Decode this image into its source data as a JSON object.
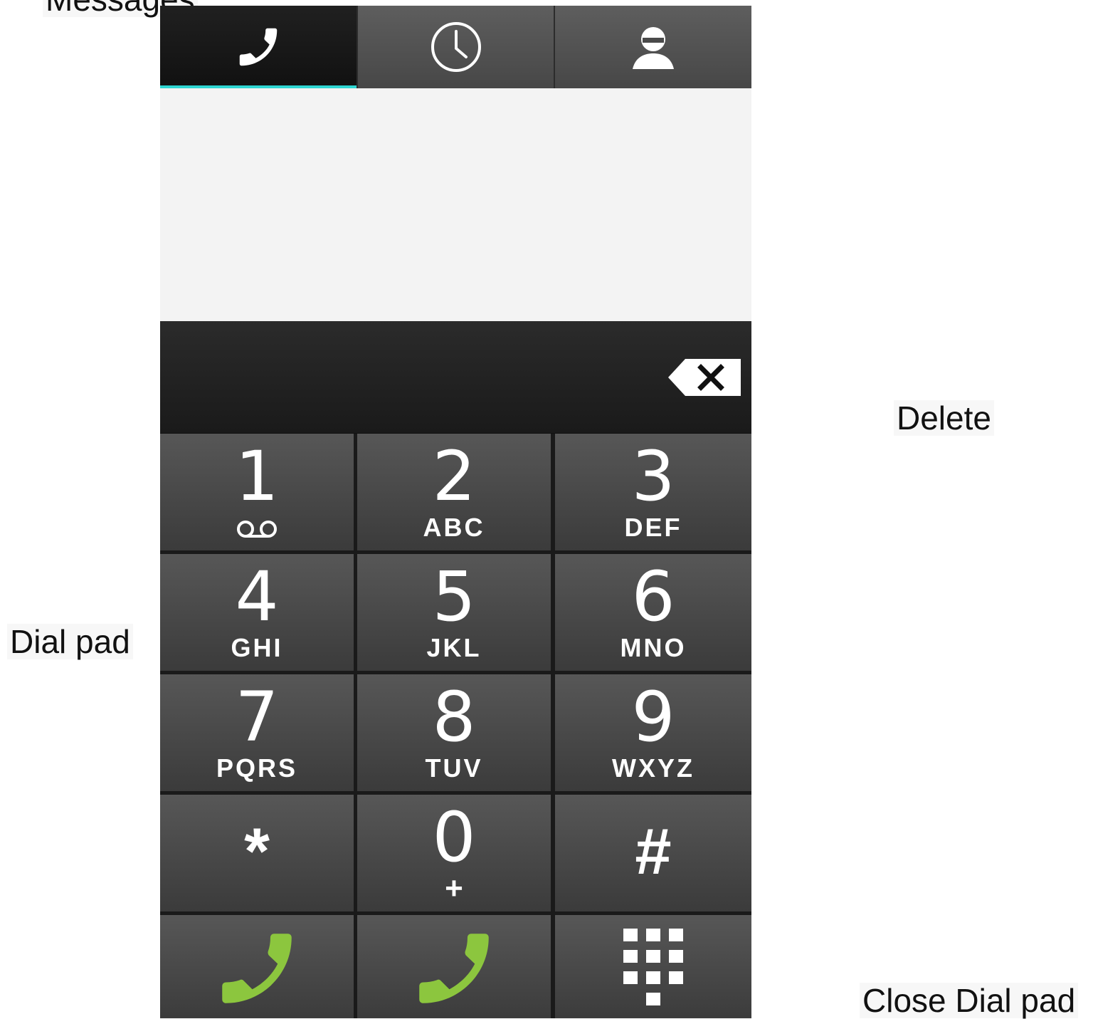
{
  "annotations": {
    "top_partial": "Messages",
    "delete": "Delete",
    "dial_pad": "Dial pad",
    "close_dial_pad": "Close Dial pad"
  },
  "tabs": [
    {
      "name": "phone-tab",
      "icon": "phone-icon",
      "active": true
    },
    {
      "name": "recent-tab",
      "icon": "clock-icon",
      "active": false
    },
    {
      "name": "contacts-tab",
      "icon": "contact-icon",
      "active": false
    }
  ],
  "colors": {
    "accent": "#2fd6d2",
    "call_green": "#8cc63e",
    "key_bg": "#4a4a4a"
  },
  "dialer": {
    "digits": "",
    "delete_icon": "backspace-icon"
  },
  "keys": [
    {
      "num": "1",
      "letters": ""
    },
    {
      "num": "2",
      "letters": "ABC"
    },
    {
      "num": "3",
      "letters": "DEF"
    },
    {
      "num": "4",
      "letters": "GHI"
    },
    {
      "num": "5",
      "letters": "JKL"
    },
    {
      "num": "6",
      "letters": "MNO"
    },
    {
      "num": "7",
      "letters": "PQRS"
    },
    {
      "num": "8",
      "letters": "TUV"
    },
    {
      "num": "9",
      "letters": "WXYZ"
    },
    {
      "num": "*",
      "letters": ""
    },
    {
      "num": "0",
      "letters": "+"
    },
    {
      "num": "#",
      "letters": ""
    }
  ],
  "bottom_row": [
    {
      "name": "call-button-1",
      "icon": "call-icon"
    },
    {
      "name": "call-button-2",
      "icon": "call-icon"
    },
    {
      "name": "close-dialpad-button",
      "icon": "dialpad-icon"
    }
  ]
}
